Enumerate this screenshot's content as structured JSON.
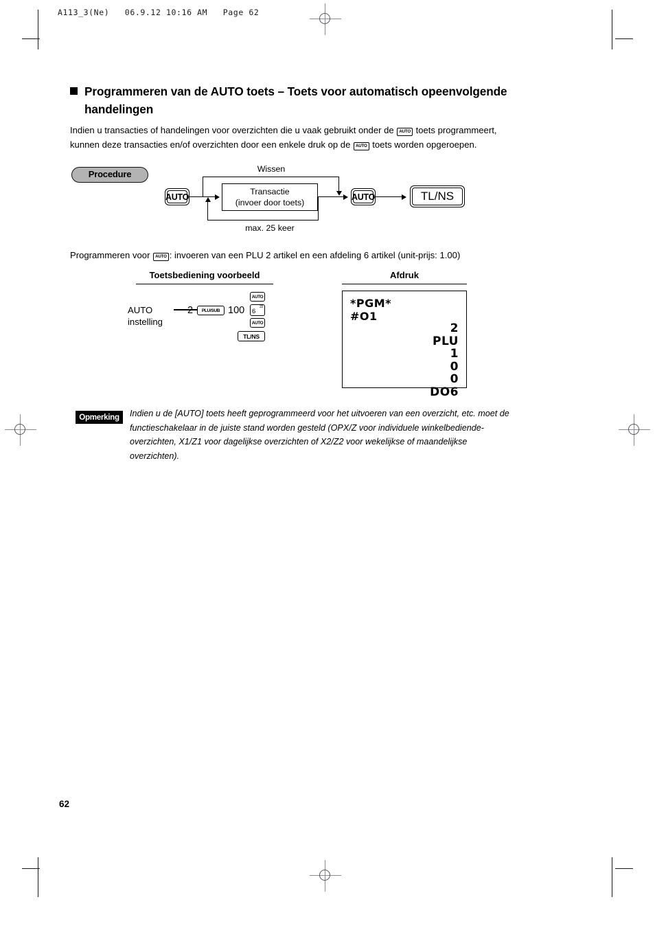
{
  "file_header": "A113_3(Ne)   06.9.12 10:16 AM   Page 62",
  "title": {
    "line1": "Programmeren van de AUTO toets – Toets voor automatisch opeenvolgende",
    "line2": "handelingen"
  },
  "intro": {
    "part1": "Indien u transacties of handelingen voor overzichten die u vaak gebruikt onder de ",
    "key1": "AUTO",
    "part2": " toets programmeert,",
    "part3": "kunnen deze transacties en/of overzichten door een enkele druk op de ",
    "key2": "AUTO",
    "part4": " toets worden opgeroepen."
  },
  "procedure": {
    "badge_label": "Procedure",
    "key_auto_start": "AUTO",
    "transaction_line1": "Transactie",
    "transaction_line2": "(invoer door toets)",
    "label_clear": "Wissen",
    "label_max": "max. 25 keer",
    "key_auto_end": "AUTO",
    "key_tlns": "TL/NS"
  },
  "program_for": {
    "prefix": "Programmeren voor ",
    "key": "AUTO",
    "suffix": ": invoeren van een PLU 2 artikel en een afdeling 6 artikel (unit-prijs: 1.00)"
  },
  "columns": {
    "keys_heading": "Toetsbediening voorbeeld",
    "print_heading": "Afdruk"
  },
  "key_operation": {
    "label_line1": "AUTO",
    "label_line2": "instelling",
    "num_plu": "2",
    "key_plusub": "PLU/SUB",
    "num_price": "100",
    "key_dept_main": "6",
    "key_dept_sup": "22",
    "key_auto_top": "AUTO",
    "key_auto_bottom": "AUTO",
    "key_tlns": "TL/NS"
  },
  "receipt": {
    "left_line1": "*PGM*",
    "left_line2": "#O1",
    "right_lines": [
      "2",
      "PLU",
      "1",
      "0",
      "0",
      "DO6"
    ]
  },
  "note": {
    "badge_label": "Opmerking",
    "line1": "Indien u de [AUTO] toets heeft geprogrammeerd voor het uitvoeren van een overzicht, etc. moet de",
    "line2": "functieschakelaar in de juiste stand worden gesteld (OPX/Z voor individuele winkelbediende-",
    "line3": "overzichten, X1/Z1 voor dagelijkse overzichten of X2/Z2 voor wekelijkse of maandelijkse",
    "line4": "overzichten)."
  },
  "page_number": "62"
}
